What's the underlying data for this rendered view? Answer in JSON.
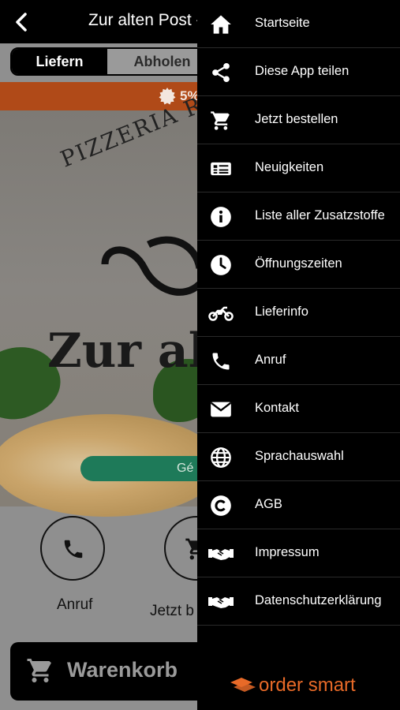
{
  "app": {
    "title": "Zur alten Post -",
    "tabs": {
      "deliver": "Liefern",
      "pickup": "Abholen"
    },
    "promo_text": "5%",
    "hero": {
      "arc_text": "PIZZERIA R",
      "title_text": "Zur alt",
      "pill_text": "Gé"
    },
    "quick_actions": {
      "call": "Anruf",
      "order": "Jetzt b"
    },
    "cart_label": "Warenkorb"
  },
  "drawer": {
    "items": [
      {
        "label": "Startseite",
        "icon": "home-icon"
      },
      {
        "label": "Diese App teilen",
        "icon": "share-icon"
      },
      {
        "label": "Jetzt bestellen",
        "icon": "cart-icon"
      },
      {
        "label": "Neuigkeiten",
        "icon": "news-icon"
      },
      {
        "label": "Liste aller Zusatzstoffe",
        "icon": "info-icon"
      },
      {
        "label": "Öffnungszeiten",
        "icon": "clock-icon"
      },
      {
        "label": "Lieferinfo",
        "icon": "motorcycle-icon"
      },
      {
        "label": "Anruf",
        "icon": "phone-icon"
      },
      {
        "label": "Kontakt",
        "icon": "envelope-icon"
      },
      {
        "label": "Sprachauswahl",
        "icon": "globe-icon"
      },
      {
        "label": "AGB",
        "icon": "copyright-icon"
      },
      {
        "label": "Impressum",
        "icon": "handshake-icon"
      },
      {
        "label": "Datenschutzerklärung",
        "icon": "handshake-icon"
      }
    ],
    "brand": "order smart"
  },
  "colors": {
    "brand_orange": "#e86a28",
    "promo_bar": "#b04a18",
    "pill_green": "#1e7a59"
  }
}
